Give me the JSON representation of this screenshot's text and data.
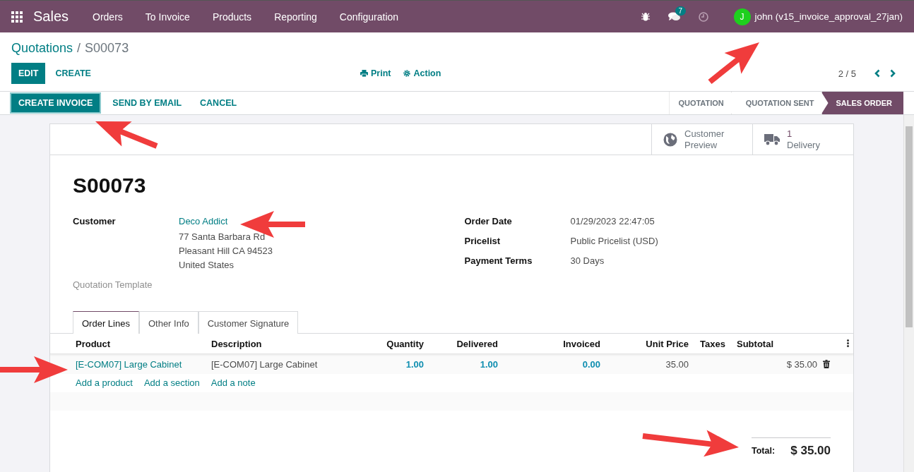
{
  "navbar": {
    "app_name": "Sales",
    "menu": [
      "Orders",
      "To Invoice",
      "Products",
      "Reporting",
      "Configuration"
    ],
    "chat_count": "7",
    "user": {
      "initial": "J",
      "name": "john (v15_invoice_approval_27jan)"
    }
  },
  "breadcrumb": {
    "parent": "Quotations",
    "separator": "/",
    "current": "S00073"
  },
  "main_buttons": [
    {
      "label": "EDIT",
      "kind": "primary"
    },
    {
      "label": "CREATE",
      "kind": "link"
    }
  ],
  "actions": [
    {
      "label": "Print",
      "kind": "print"
    },
    {
      "label": "Action",
      "kind": "gear"
    }
  ],
  "pager": "2 / 5",
  "status_buttons": [
    {
      "label": "CREATE INVOICE",
      "kind": "primary"
    },
    {
      "label": "SEND BY EMAIL",
      "kind": "link"
    },
    {
      "label": "CANCEL",
      "kind": "link"
    }
  ],
  "stages": [
    {
      "label": "QUOTATION",
      "selected": false
    },
    {
      "label": "QUOTATION SENT",
      "selected": false
    },
    {
      "label": "SALES ORDER",
      "selected": true
    }
  ],
  "smart_buttons": [
    {
      "kind": "preview",
      "lines": [
        "Customer",
        "Preview"
      ]
    },
    {
      "kind": "delivery",
      "lines": [
        "1",
        "Delivery"
      ]
    }
  ],
  "title": "S00073",
  "customer": {
    "label": "Customer",
    "name": "Deco Addict",
    "address": [
      "77 Santa Barbara Rd",
      "Pleasant Hill CA 94523",
      "United States"
    ]
  },
  "quotation_template": {
    "label": "Quotation Template"
  },
  "right_fields": [
    {
      "label": "Order Date",
      "value": "01/29/2023 22:47:05"
    },
    {
      "label": "Pricelist",
      "value": "Public Pricelist (USD)"
    },
    {
      "label": "Payment Terms",
      "value": "30 Days"
    }
  ],
  "tabs": [
    {
      "label": "Order Lines",
      "selected": true
    },
    {
      "label": "Other Info",
      "selected": false
    },
    {
      "label": "Customer Signature",
      "selected": false
    }
  ],
  "table": {
    "columns": [
      "Product",
      "Description",
      "Quantity",
      "Delivered",
      "Invoiced",
      "Unit Price",
      "Taxes",
      "Subtotal"
    ],
    "rows": [
      {
        "product": "[E-COM07] Large Cabinet",
        "description": "[E-COM07] Large Cabinet",
        "quantity": "1.00",
        "delivered": "1.00",
        "invoiced": "0.00",
        "unit_price": "35.00",
        "subtotal": "$ 35.00"
      }
    ],
    "add_links": [
      "Add a product",
      "Add a section",
      "Add a note"
    ]
  },
  "total": {
    "label": "Total:",
    "value": "$ 35.00"
  }
}
